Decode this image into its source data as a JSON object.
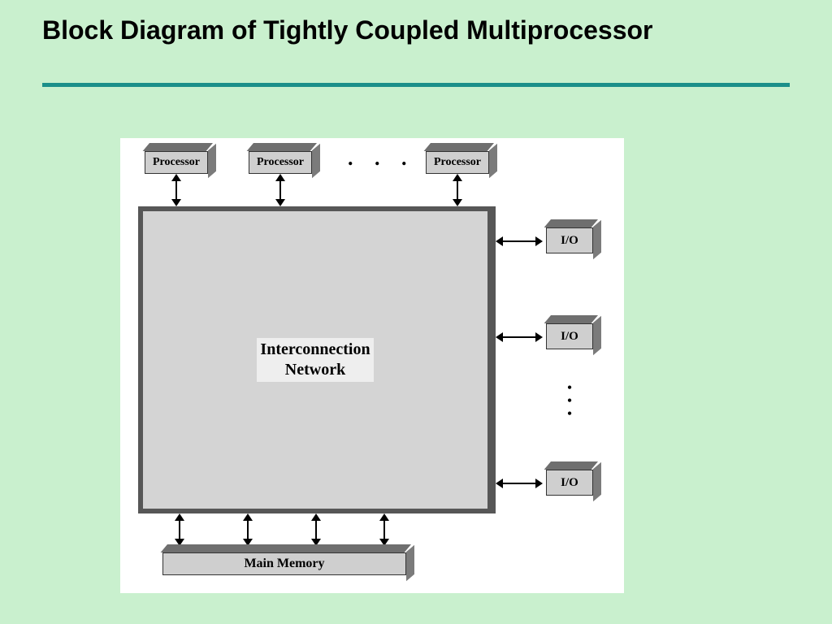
{
  "title": "Block Diagram of Tightly Coupled Multiprocessor",
  "blocks": {
    "processor": "Processor",
    "io": "I/O",
    "interconnect_l1": "Interconnection",
    "interconnect_l2": "Network",
    "memory": "Main Memory"
  },
  "ellipsis": ".  .  ."
}
